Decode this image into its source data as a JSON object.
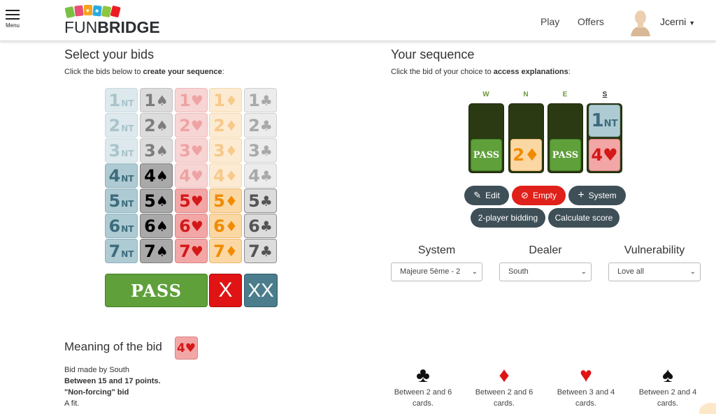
{
  "header": {
    "menu_label": "Menu",
    "logo_fun": "FUN",
    "logo_bridge": "BRIDGE",
    "nav": [
      {
        "label": "Play"
      },
      {
        "label": "Offers"
      }
    ],
    "username": "Jcerni"
  },
  "left": {
    "title": "Select your bids",
    "subtitle_prefix": "Click the bids below to ",
    "subtitle_bold": "create your sequence",
    "subtitle_suffix": ":"
  },
  "bidbox": {
    "rows": [
      {
        "level": "1",
        "available": false,
        "nt_available": false
      },
      {
        "level": "2",
        "available": false
      },
      {
        "level": "3",
        "available": false
      },
      {
        "level": "4",
        "available": false
      },
      {
        "level": "5",
        "available": true
      },
      {
        "level": "6",
        "available": true
      },
      {
        "level": "7",
        "available": true
      }
    ],
    "available_map": [
      [
        false,
        false,
        false,
        false,
        false
      ],
      [
        false,
        false,
        false,
        false,
        false
      ],
      [
        false,
        false,
        false,
        false,
        false
      ],
      [
        true,
        true,
        false,
        false,
        false
      ],
      [
        true,
        true,
        true,
        true,
        true
      ],
      [
        true,
        true,
        true,
        true,
        true
      ],
      [
        true,
        true,
        true,
        true,
        true
      ]
    ],
    "denominations": [
      {
        "name": "nt",
        "symbol": "NT"
      },
      {
        "name": "spades",
        "symbol": "♠"
      },
      {
        "name": "hearts",
        "symbol": "♥"
      },
      {
        "name": "diamonds",
        "symbol": "♦"
      },
      {
        "name": "clubs",
        "symbol": "♣"
      }
    ],
    "pass_label": "PASS",
    "double_label": "X",
    "redouble_label": "XX"
  },
  "right": {
    "title": "Your sequence",
    "subtitle_prefix": "Click the bid of your choice to ",
    "subtitle_bold": "access explanations",
    "subtitle_suffix": ":"
  },
  "sequence": {
    "seats": [
      "W",
      "N",
      "E",
      "S"
    ],
    "active_seat": "S",
    "bids": {
      "S_first_level": "1",
      "S_first_den": "NT",
      "W_bid": "PASS",
      "N_bid_level": "2",
      "N_bid_den": "♦",
      "E_bid": "PASS",
      "S_bid_level": "4",
      "S_bid_den": "♥"
    }
  },
  "actions": {
    "edit": "Edit",
    "empty": "Empty",
    "system": "System",
    "two_player": "2-player bidding",
    "calc": "Calculate score"
  },
  "settings": {
    "system_label": "System",
    "system_value": "Majeure 5ème - 2",
    "dealer_label": "Dealer",
    "dealer_value": "South",
    "vuln_label": "Vulnerability",
    "vuln_value": "Love all"
  },
  "meaning": {
    "title": "Meaning of the bid",
    "badge": "4♥",
    "line1": "Bid made by South",
    "line2": "Between 15 and 17 points.",
    "line3": "\"Non-forcing\" bid",
    "line4": "A fit.",
    "suits": [
      {
        "glyph": "♣",
        "text": "Between 2 and 6 cards.",
        "color": "#111111"
      },
      {
        "glyph": "♦",
        "text": "Between 2 and 6 cards.",
        "color": "#e01414"
      },
      {
        "glyph": "♥",
        "text": "Between 3 and 4 cards.",
        "color": "#e01414"
      },
      {
        "glyph": "♠",
        "text": "Between 2 and 4 cards.",
        "color": "#111111"
      }
    ]
  },
  "colors": {
    "accent_green": "#5fa03a",
    "accent_red": "#e0201a",
    "pill_dark": "#3e4f57"
  }
}
